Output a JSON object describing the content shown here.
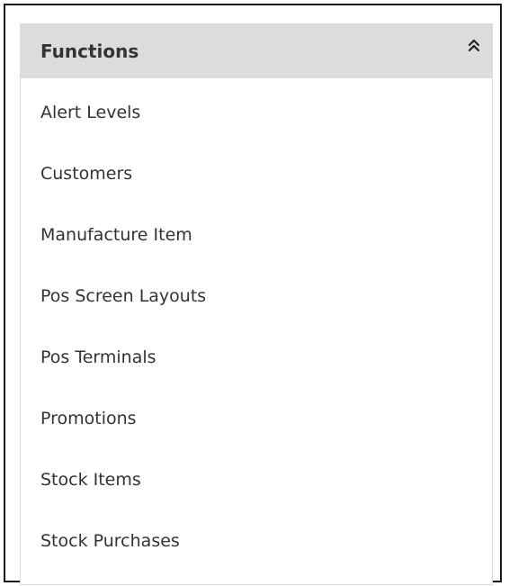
{
  "panel": {
    "title": "Functions",
    "collapse_icon": "double-chevron-up-icon",
    "items": [
      {
        "label": "Alert Levels"
      },
      {
        "label": "Customers"
      },
      {
        "label": "Manufacture Item"
      },
      {
        "label": "Pos Screen Layouts"
      },
      {
        "label": "Pos Terminals"
      },
      {
        "label": "Promotions"
      },
      {
        "label": "Stock Items"
      },
      {
        "label": "Stock Purchases"
      }
    ]
  }
}
